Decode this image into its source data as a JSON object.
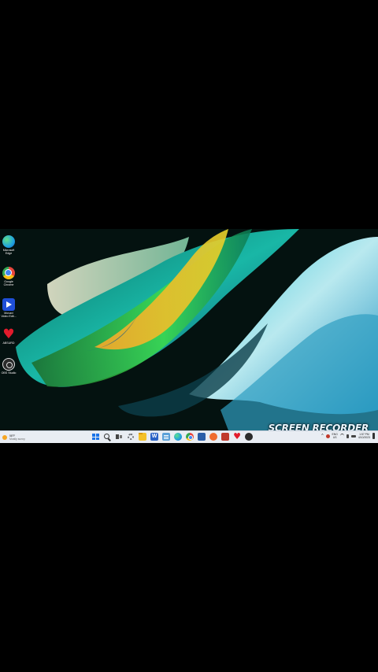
{
  "desktop": {
    "icons": [
      {
        "id": "edge",
        "label": "Microsoft Edge",
        "icon": "edge-icon",
        "color": "#1fa2e0"
      },
      {
        "id": "chrome",
        "label": "Google Chrome",
        "icon": "chrome-icon",
        "color": "#e8453c"
      },
      {
        "id": "video-editor",
        "label": "Movavi Video Edit...",
        "icon": "video-editor-icon",
        "color": "#1f4fd8"
      },
      {
        "id": "app-heart",
        "label": "ABSURD",
        "icon": "heart-icon",
        "color": "#e21b2c"
      },
      {
        "id": "obs",
        "label": "OBS Studio",
        "icon": "obs-icon",
        "color": "#2b2b2b"
      }
    ]
  },
  "watermark": {
    "text": "SCREEN RECORDER"
  },
  "taskbar": {
    "weather": {
      "temp": "58°F",
      "condition": "Mostly sunny"
    },
    "apps": [
      {
        "name": "start",
        "icon": "windows-start-icon",
        "color": "#1a73e8"
      },
      {
        "name": "search",
        "icon": "search-icon",
        "color": "#333333"
      },
      {
        "name": "task-view",
        "icon": "task-view-icon",
        "color": "#444444"
      },
      {
        "name": "settings",
        "icon": "gear-icon",
        "color": "#6b6f75"
      },
      {
        "name": "file-explorer",
        "icon": "folder-icon",
        "color": "#f4c12a"
      },
      {
        "name": "word",
        "icon": "word-icon",
        "color": "#2b63c6"
      },
      {
        "name": "notepad",
        "icon": "notepad-icon",
        "color": "#5aa0d8"
      },
      {
        "name": "edge",
        "icon": "edge-icon",
        "color": "#1fa2e0"
      },
      {
        "name": "chrome",
        "icon": "chrome-icon",
        "color": "#e8453c"
      },
      {
        "name": "store",
        "icon": "store-icon",
        "color": "#2a5ea8"
      },
      {
        "name": "app-orange",
        "icon": "app-icon",
        "color": "#ef6c2f"
      },
      {
        "name": "app-red",
        "icon": "app-icon",
        "color": "#c0392b"
      },
      {
        "name": "app-heart",
        "icon": "heart-icon",
        "color": "#e21b2c"
      },
      {
        "name": "obs",
        "icon": "obs-icon",
        "color": "#2b2b2b"
      }
    ],
    "tray": {
      "lang_top": "ENG",
      "lang_bottom": "US",
      "time": "1:57 PM",
      "date": "4/10/2023"
    }
  }
}
